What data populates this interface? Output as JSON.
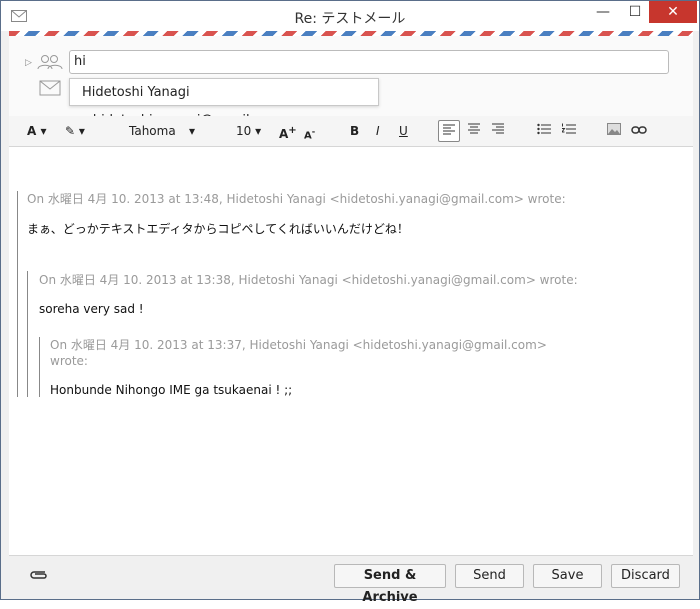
{
  "window": {
    "title": "Re: テストメール",
    "minimize_label": "—",
    "maximize_label": "☐",
    "close_label": "✕"
  },
  "compose": {
    "to_value": "hi",
    "suggestion": "Hidetoshi Yanagi <hidetoshi.yanagi@gmail.com>"
  },
  "toolbar": {
    "text_color_label": "A",
    "highlight_label": "✎",
    "font_name": "Tahoma",
    "font_size": "10",
    "grow_label": "A",
    "shrink_label": "A",
    "bold_label": "B",
    "italic_label": "I",
    "underline_label": "U"
  },
  "quotes": [
    {
      "header": "On 水曜日 4月 10. 2013 at 13:48, Hidetoshi Yanagi <hidetoshi.yanagi@gmail.com> wrote:",
      "body": "まぁ、どっかテキストエディタからコピペしてくればいいんだけどね！"
    },
    {
      "header": "On 水曜日 4月 10. 2013 at 13:38, Hidetoshi Yanagi <hidetoshi.yanagi@gmail.com> wrote:",
      "body": "soreha very sad !"
    },
    {
      "header_line1": "On 水曜日 4月 10. 2013 at 13:37, Hidetoshi Yanagi <hidetoshi.yanagi@gmail.com>",
      "header_line2": "wrote:",
      "body": "Honbunde Nihongo IME ga tsukaenai ! ;;"
    }
  ],
  "actions": {
    "send_archive": "Send & Archive",
    "send": "Send",
    "save": "Save",
    "discard": "Discard"
  },
  "colors": {
    "close_button": "#c7362d",
    "quote_header": "#9a9a9a"
  }
}
